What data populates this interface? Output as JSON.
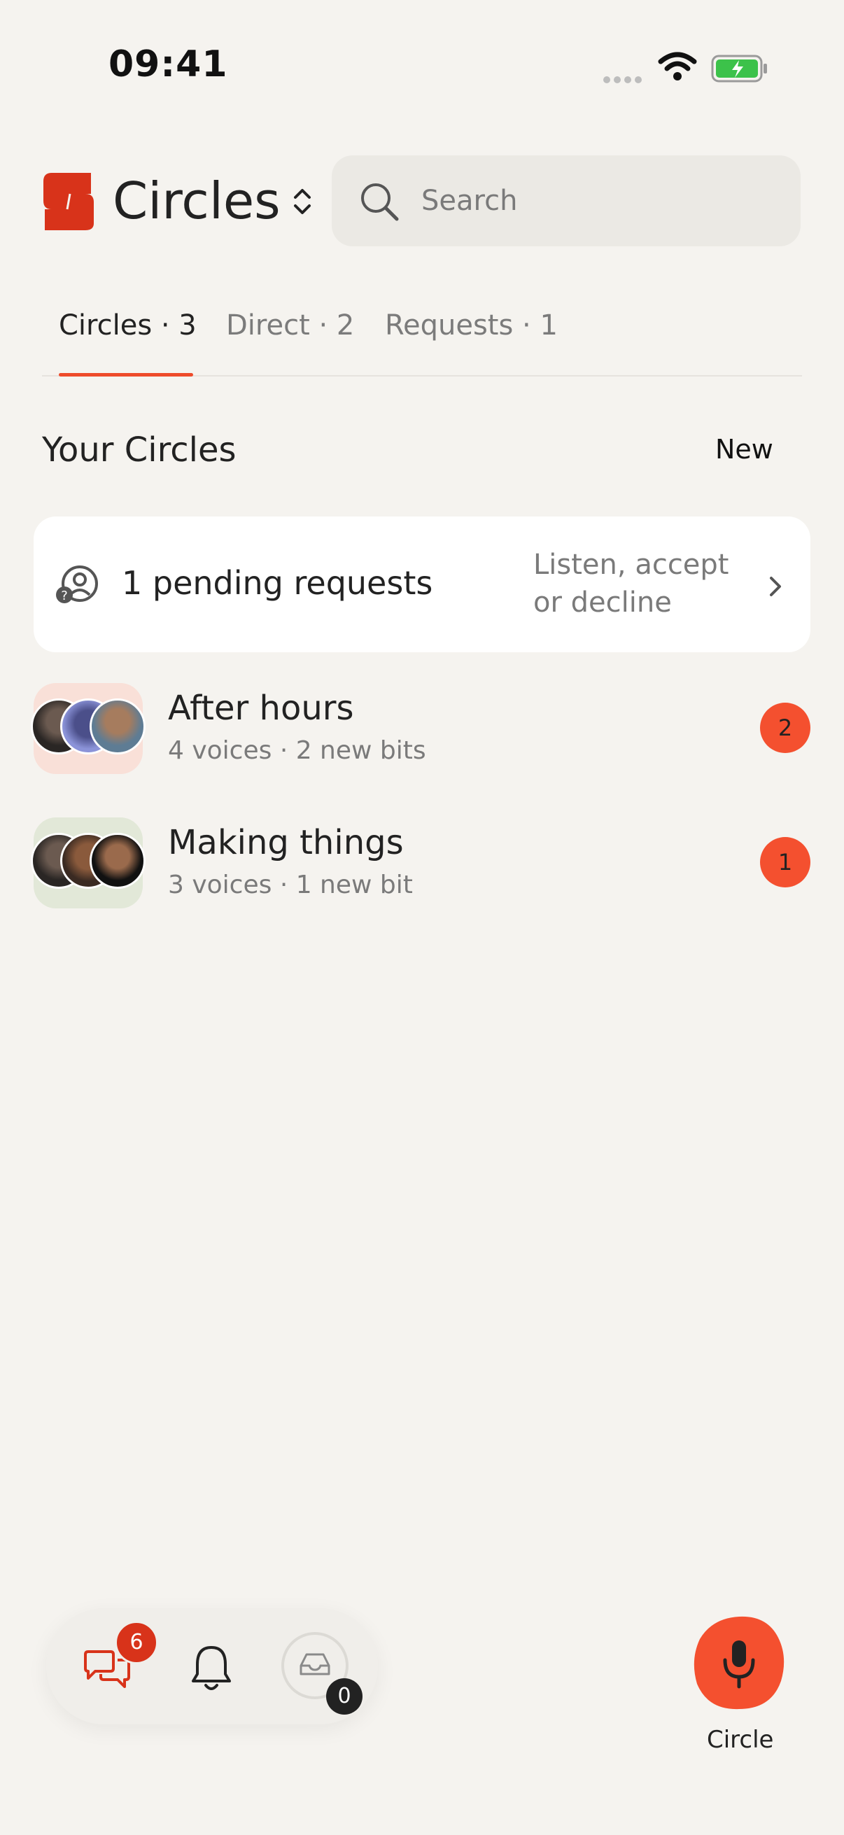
{
  "status": {
    "time": "09:41"
  },
  "header": {
    "app_title": "Circles",
    "search_placeholder": "Search"
  },
  "tabs": [
    {
      "label": "Circles · 3",
      "active": true
    },
    {
      "label": "Direct · 2",
      "active": false
    },
    {
      "label": "Requests · 1",
      "active": false
    }
  ],
  "section": {
    "title": "Your Circles",
    "new_label": "New"
  },
  "pending": {
    "label": "1 pending requests",
    "hint": "Listen, accept or decline"
  },
  "circles": [
    {
      "name": "After hours",
      "subtitle": "4 voices · 2 new bits",
      "unread": "2",
      "tile_color": "#f9e0d8"
    },
    {
      "name": "Making things",
      "subtitle": "3 voices · 1 new bit",
      "unread": "1",
      "tile_color": "#e2e8d8"
    }
  ],
  "dock": {
    "chat_count": "6",
    "inbox_count": "0"
  },
  "record": {
    "label": "Circle"
  },
  "colors": {
    "accent": "#f4502f",
    "brand": "#d8331a",
    "background": "#f5f3ef"
  }
}
